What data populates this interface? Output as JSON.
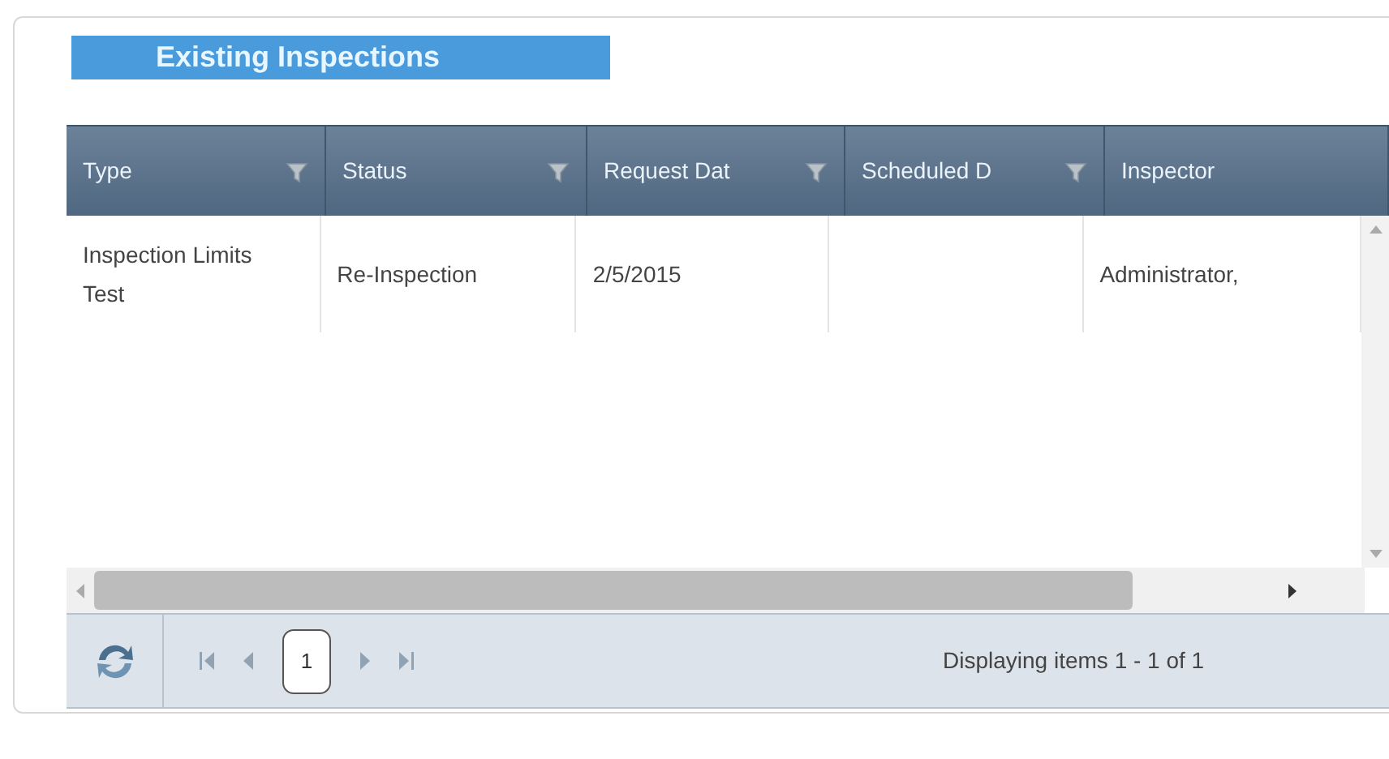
{
  "panel": {
    "title": "Existing Inspections"
  },
  "table": {
    "columns": [
      {
        "label": "Type",
        "filter": true
      },
      {
        "label": "Status",
        "filter": true
      },
      {
        "label": "Request Dat",
        "filter": true
      },
      {
        "label": "Scheduled D",
        "filter": true
      },
      {
        "label": "Inspector",
        "filter": false
      }
    ],
    "rows": [
      {
        "cells": [
          "Inspection Limits Test",
          "Re-Inspection",
          "2/5/2015",
          "",
          "Administrator,"
        ]
      }
    ]
  },
  "pager": {
    "page": "1",
    "summary": "Displaying items 1 - 1 of 1"
  }
}
